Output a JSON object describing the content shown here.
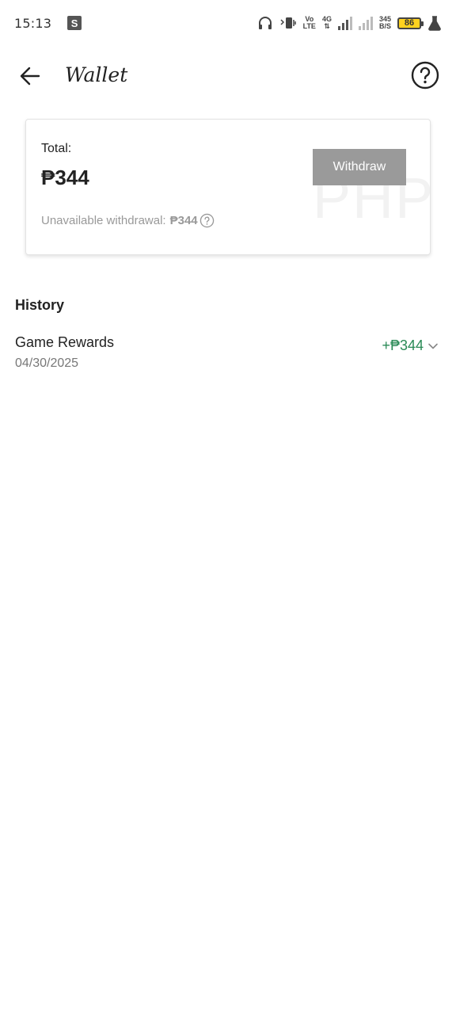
{
  "status_bar": {
    "time": "15:13",
    "s_badge": "S",
    "volte_top": "Vo",
    "volte_bottom": "LTE",
    "network_type": "4G",
    "network_arrows": "⇅",
    "speed_value": "345",
    "speed_unit": "B/S",
    "battery_level": "86"
  },
  "header": {
    "title": "Wallet"
  },
  "wallet": {
    "total_label": "Total:",
    "total_amount": "₱344",
    "withdraw_label": "Withdraw",
    "watermark": "PHP",
    "unavailable_label": "Unavailable withdrawal:",
    "unavailable_amount": "₱344"
  },
  "history": {
    "title": "History",
    "items": [
      {
        "title": "Game Rewards",
        "date": "04/30/2025",
        "amount": "+₱344"
      }
    ]
  },
  "colors": {
    "accent_green": "#2a8a56",
    "button_gray": "#9a9a9a",
    "battery_yellow": "#ffd21f"
  }
}
